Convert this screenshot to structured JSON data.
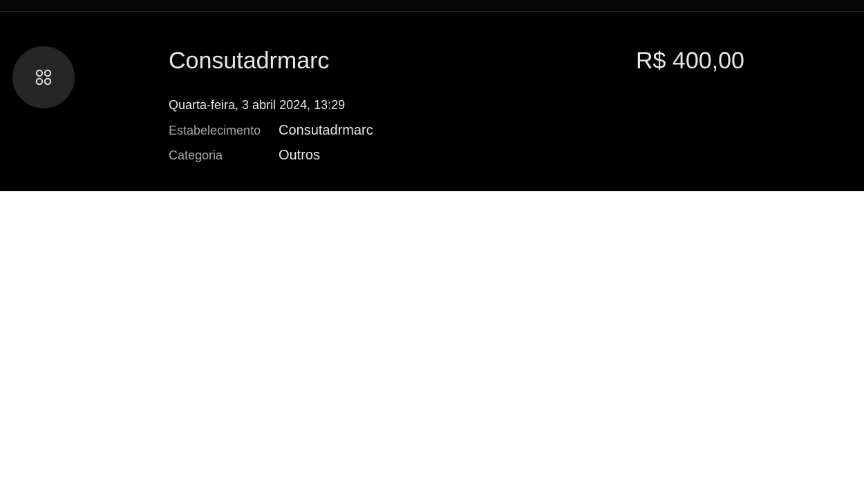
{
  "transaction": {
    "title": "Consutadrmarc",
    "amount": "R$ 400,00",
    "datetime": "Quarta-feira, 3 abril 2024, 13:29",
    "category_icon": "category-grid-icon",
    "details": [
      {
        "label": "Estabelecimento",
        "value": "Consutadrmarc"
      },
      {
        "label": "Categoria",
        "value": "Outros"
      }
    ]
  },
  "colors": {
    "panel_background": "#000000",
    "badge_background": "#262626",
    "primary_text": "#e6e6e6",
    "secondary_text": "#a6a6a6"
  }
}
